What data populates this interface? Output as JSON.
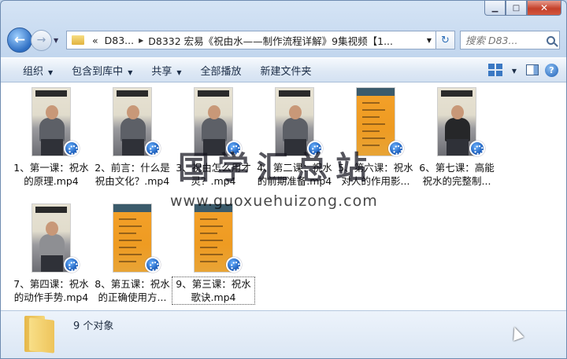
{
  "address": {
    "crumbs": [
      "D83...",
      "D8332 宏易《祝由水——制作流程详解》9集视频【1..."
    ],
    "prefix": "«"
  },
  "search": {
    "placeholder": "搜索 D83..."
  },
  "toolbar": {
    "organize": "组织",
    "include_library": "包含到库中",
    "share": "共享",
    "play_all": "全部播放",
    "new_folder": "新建文件夹"
  },
  "files": [
    {
      "name": "1、第一课：祝水的原理.mp4",
      "thumb": "person"
    },
    {
      "name": "2、前言：什么是祝由文化？.mp4",
      "thumb": "person"
    },
    {
      "name": "3、祝由怎么用才灵？.mp4",
      "thumb": "person"
    },
    {
      "name": "4、第二课：祝水的前期准备.mp4",
      "thumb": "person"
    },
    {
      "name": "5、第六课：祝水对人的作用影...",
      "thumb": "orange"
    },
    {
      "name": "6、第七课：高能祝水的完整制...",
      "thumb": "person-dark"
    },
    {
      "name": "7、第四课：祝水的动作手势.mp4",
      "thumb": "person-light"
    },
    {
      "name": "8、第五课：祝水的正确使用方...",
      "thumb": "orange"
    },
    {
      "name": "9、第三课：祝水 歌诀.mp4",
      "thumb": "orange"
    }
  ],
  "watermark": {
    "text": "国学汇总站",
    "url": "www.guoxuehuizong.com"
  },
  "status": {
    "count": "9 个对象"
  }
}
